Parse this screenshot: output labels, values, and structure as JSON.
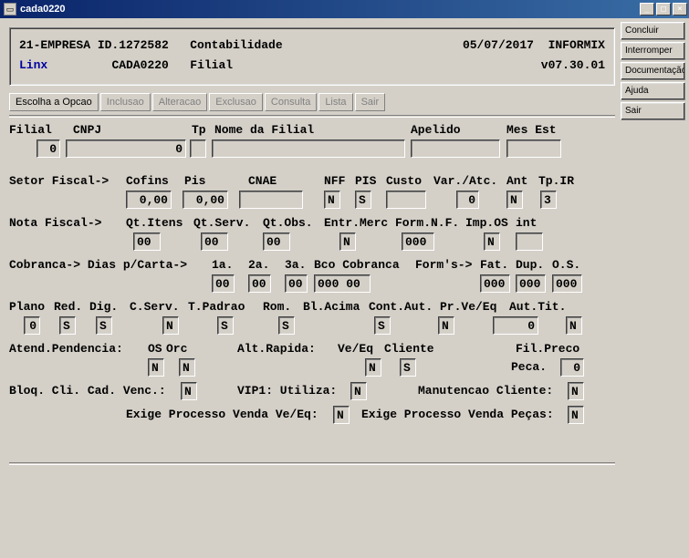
{
  "window": {
    "title": "cada0220"
  },
  "right_buttons": {
    "concluir": "Concluir",
    "interromper": "Interromper",
    "documentacao": "Documentação",
    "ajuda": "Ajuda",
    "sair": "Sair"
  },
  "header": {
    "empresa": "21-EMPRESA ID.1272582",
    "modulo": "Contabilidade",
    "data": "05/07/2017",
    "db": "INFORMIX",
    "vendor": "Linx",
    "programa": "CADA0220",
    "filial_label": "Filial",
    "versao": "v07.30.01"
  },
  "menu": {
    "escolha": "Escolha a Opcao",
    "inclusao": "Inclusao",
    "alteracao": "Alteracao",
    "exclusao": "Exclusao",
    "consulta": "Consulta",
    "lista": "Lista",
    "sair": "Sair"
  },
  "labels": {
    "row1": {
      "filial": "Filial",
      "cnpj": "CNPJ",
      "tp": "Tp",
      "nome": "Nome da Filial",
      "apelido": "Apelido",
      "mesest": "Mes Est"
    },
    "row2": {
      "setor": "Setor Fiscal->",
      "cofins": "Cofins",
      "pis": "Pis",
      "cnae": "CNAE",
      "nff": "NFF",
      "piscol": "PIS",
      "custo": "Custo",
      "varatc": "Var./Atc.",
      "ant": "Ant",
      "tpir": "Tp.IR"
    },
    "row3": {
      "nota": "Nota Fiscal->",
      "qtitens": "Qt.Itens",
      "qtserv": "Qt.Serv.",
      "qtobs": "Qt.Obs.",
      "entrmerc": "Entr.Merc",
      "formnf": "Form.N.F.",
      "impos": "Imp.OS",
      "int": "int"
    },
    "row4": {
      "cobranca": "Cobranca-> Dias p/Carta->",
      "a1": "1a.",
      "a2": "2a.",
      "a3": "3a.",
      "bco": "Bco Cobranca",
      "forms": "Form's->",
      "fat": "Fat.",
      "dup": "Dup.",
      "os": "O.S."
    },
    "row5": {
      "plano": "Plano",
      "reddig": "Red. Dig.",
      "cserv": "C.Serv.",
      "tpadrao": "T.Padrao",
      "rom": "Rom.",
      "blacima": "Bl.Acima",
      "contaut": "Cont.Aut.",
      "prveeq": "Pr.Ve/Eq",
      "auttit": "Aut.Tit."
    },
    "row6": {
      "atend": "Atend.Pendencia:",
      "os": "OS",
      "orc": "Orc",
      "altrapida": "Alt.Rapida:",
      "veeq": "Ve/Eq",
      "cliente": "Cliente",
      "filpreco": "Fil.Preco"
    },
    "row7": {
      "peca": "Peca."
    },
    "row8": {
      "bloq": "Bloq. Cli. Cad. Venc.:",
      "vip1": "VIP1: Utiliza:",
      "manut": "Manutencao Cliente:"
    },
    "row9": {
      "exige1": "Exige Processo Venda Ve/Eq:",
      "exige2": "Exige Processo Venda Peças:"
    }
  },
  "values": {
    "filial": "0",
    "cnpj": "0",
    "tp": "",
    "nome": "",
    "apelido": "",
    "mesest": "",
    "cofins": "0,00",
    "pis": "0,00",
    "cnae": "",
    "nff": "N",
    "piscol": "S",
    "custo": "",
    "varatc": "0",
    "ant": "N",
    "tpir": "3",
    "qtitens": "00",
    "qtserv": "00",
    "qtobs": "00",
    "entrmerc": "N",
    "formnf": "000",
    "impos": "N",
    "int": "",
    "c1a": "00",
    "c2a": "00",
    "c3a": "00",
    "bco": "000 00",
    "fat": "000",
    "dup": "000",
    "os": "000",
    "plano": "0",
    "reddig": "S",
    "cserv": "S",
    "tpadrao": "N",
    "rom": "S",
    "blacima": "S",
    "contaut": "S",
    "prveeq_aut": "N",
    "auttit_val": "0",
    "auttit_flag": "N",
    "atend_os": "N",
    "atend_orc": "N",
    "alt_veeq": "N",
    "alt_cliente": "S",
    "filpreco_peca": "0",
    "bloq": "N",
    "vip1": "N",
    "manut": "N",
    "exige1": "N",
    "exige2": "N"
  }
}
